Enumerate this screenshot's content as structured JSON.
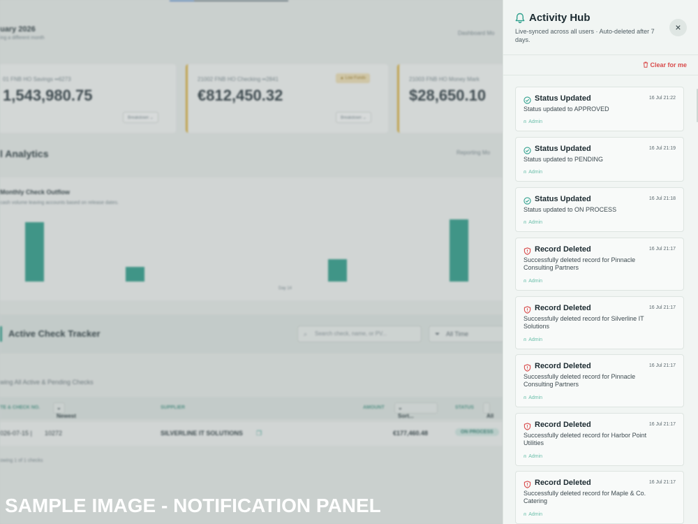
{
  "background": {
    "month_title": "uary 2026",
    "month_sub": "ing a different month",
    "dashboard_mode": "Dashboard Mo",
    "cards": [
      {
        "account": "01 FNB HO Savings ••6273",
        "amount": "1,543,980.75",
        "breakdown": "Breakdown",
        "badge": ""
      },
      {
        "account": "21002 FNB HO Checking ••2841",
        "amount": "€812,450.32",
        "breakdown": "Breakdown",
        "badge": "Low Funds"
      },
      {
        "account": "21003 FNB HO Money Mark",
        "amount": "$28,650.10",
        "breakdown": "",
        "badge": ""
      }
    ],
    "analytics_title": "l Analytics",
    "reporting_mode": "Reporting Mo",
    "chart_data": {
      "type": "bar",
      "title": "Monthly Check Outflow",
      "subtitle": "cash volume leaving accounts based on release dates.",
      "categories": [
        "",
        "",
        "",
        "",
        ""
      ],
      "tick_labels": [
        "Day 14"
      ],
      "values": [
        85,
        21,
        32,
        89,
        0
      ],
      "ylim": [
        0,
        100
      ],
      "grid": false
    },
    "tracker_title": "Active Check Tracker",
    "search_placeholder": "Search check, name, or PV...",
    "time_filter": "All Time",
    "showing": "wing All Active & Pending Checks",
    "table": {
      "headers": {
        "date": "TE & CHECK NO.",
        "date_sort": "Newest",
        "supplier": "SUPPLIER",
        "amount": "AMOUNT",
        "amount_sort": "Sort...",
        "status": "STATUS",
        "status_filter": "All"
      },
      "row": {
        "date": "026-07-15 |",
        "check_no": "10272",
        "supplier": "SILVERLINE IT SOLUTIONS",
        "amount": "€177,460.48",
        "status": "ON PROCESS"
      }
    },
    "footnote": "owing 1 of 1 checks",
    "watermark": "SAMPLE IMAGE - NOTIFICATION PANEL"
  },
  "panel": {
    "title": "Activity Hub",
    "subtitle": "Live-synced across all users · Auto-deleted after 7 days.",
    "close_icon": "×",
    "clear_label": "Clear for me",
    "colors": {
      "status": "#2fa08d",
      "delete": "#d94c4c",
      "user": "#6bbfab"
    },
    "notifications": [
      {
        "type": "status",
        "icon": "check-circle-icon",
        "title": "Status Updated",
        "time": "16 Jul 21:22",
        "message": "Status updated to APPROVED",
        "user": "Admin"
      },
      {
        "type": "status",
        "icon": "check-circle-icon",
        "title": "Status Updated",
        "time": "16 Jul 21:19",
        "message": "Status updated to PENDING",
        "user": "Admin"
      },
      {
        "type": "status",
        "icon": "check-circle-icon",
        "title": "Status Updated",
        "time": "16 Jul 21:18",
        "message": "Status updated to ON PROCESS",
        "user": "Admin"
      },
      {
        "type": "delete",
        "icon": "shield-alert-icon",
        "title": "Record Deleted",
        "time": "16 Jul 21:17",
        "message": "Successfully deleted record for Pinnacle Consulting Partners",
        "user": "Admin"
      },
      {
        "type": "delete",
        "icon": "shield-alert-icon",
        "title": "Record Deleted",
        "time": "16 Jul 21:17",
        "message": "Successfully deleted record for Silverline IT Solutions",
        "user": "Admin"
      },
      {
        "type": "delete",
        "icon": "shield-alert-icon",
        "title": "Record Deleted",
        "time": "16 Jul 21:17",
        "message": "Successfully deleted record for Pinnacle Consulting Partners",
        "user": "Admin"
      },
      {
        "type": "delete",
        "icon": "shield-alert-icon",
        "title": "Record Deleted",
        "time": "16 Jul 21:17",
        "message": "Successfully deleted record for Harbor Point Utilities",
        "user": "Admin"
      },
      {
        "type": "delete",
        "icon": "shield-alert-icon",
        "title": "Record Deleted",
        "time": "16 Jul 21:17",
        "message": "Successfully deleted record for Maple & Co. Catering",
        "user": "Admin"
      }
    ]
  }
}
